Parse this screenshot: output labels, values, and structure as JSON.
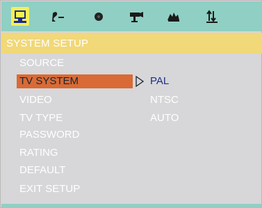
{
  "icon_bar": {
    "icons": [
      {
        "name": "monitor-icon",
        "selected": true
      },
      {
        "name": "speaker-adjust-icon",
        "selected": false
      },
      {
        "name": "disc-icon",
        "selected": false
      },
      {
        "name": "video-camera-icon",
        "selected": false
      },
      {
        "name": "audio-hand-icon",
        "selected": false
      },
      {
        "name": "sort-arrows-icon",
        "selected": false
      }
    ]
  },
  "section_title": "SYSTEM SETUP",
  "menu": {
    "items": [
      {
        "label": "SOURCE"
      },
      {
        "label": "TV SYSTEM"
      },
      {
        "label": "VIDEO"
      },
      {
        "label": "TV TYPE"
      },
      {
        "label": "PASSWORD"
      },
      {
        "label": "RATING"
      },
      {
        "label": "DEFAULT"
      },
      {
        "label": "EXIT SETUP"
      }
    ],
    "selected_index": 1
  },
  "submenu": {
    "options": [
      {
        "label": "PAL"
      },
      {
        "label": "NTSC"
      },
      {
        "label": "AUTO"
      }
    ],
    "current_index": 0
  },
  "colors": {
    "icon_bar": "#8fcfc4",
    "title_bar": "#f1d878",
    "panel": "#d7d6d8",
    "highlight": "#d96a35",
    "current_option": "#1e2f8a"
  }
}
